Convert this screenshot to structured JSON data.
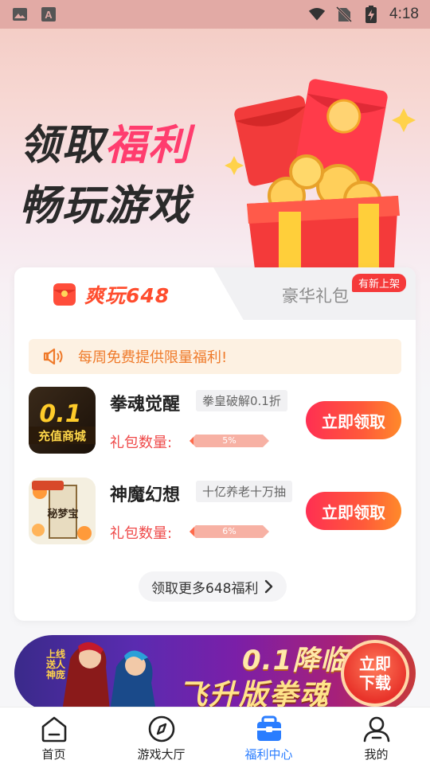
{
  "status_bar": {
    "time": "4:18",
    "icons": [
      "gallery-icon",
      "font-icon",
      "wifi-icon",
      "no-sim-icon",
      "battery-charging-icon"
    ]
  },
  "banner": {
    "line1_prefix": "领取",
    "line1_highlight": "福利",
    "line2": "畅玩游戏",
    "highlight_color": "#ff3d6e"
  },
  "tabs": {
    "active_label": "爽玩648",
    "other_label": "豪华礼包",
    "new_badge": "有新上架"
  },
  "notice": {
    "text": "每周免费提供限量福利!"
  },
  "games": [
    {
      "name": "拳魂觉醒",
      "tag": "拳皇破解0.1折",
      "pack_label": "礼包数量:",
      "progress_text": "5%",
      "progress_value": 0.05,
      "button": "立即领取",
      "icon_text": "充值商城"
    },
    {
      "name": "神魔幻想",
      "tag": "十亿养老十万抽",
      "pack_label": "礼包数量:",
      "progress_text": "6%",
      "progress_value": 0.06,
      "button": "立即领取",
      "icon_text": "秘梦宝"
    }
  ],
  "more_button": "领取更多648福利",
  "ad": {
    "small_text": "上线送人神庞",
    "title1": "0.1降临",
    "title2": "飞升版拳魂",
    "button": "立即下载"
  },
  "bottom_nav": [
    {
      "label": "首页",
      "icon": "home-icon",
      "active": false
    },
    {
      "label": "游戏大厅",
      "icon": "compass-icon",
      "active": false
    },
    {
      "label": "福利中心",
      "icon": "welfare-box-icon",
      "active": true
    },
    {
      "label": "我的",
      "icon": "user-icon",
      "active": false
    }
  ],
  "colors": {
    "accent_red": "#ff4d2e",
    "active_nav": "#2a7dff",
    "notice_orange": "#ef7a2a"
  }
}
